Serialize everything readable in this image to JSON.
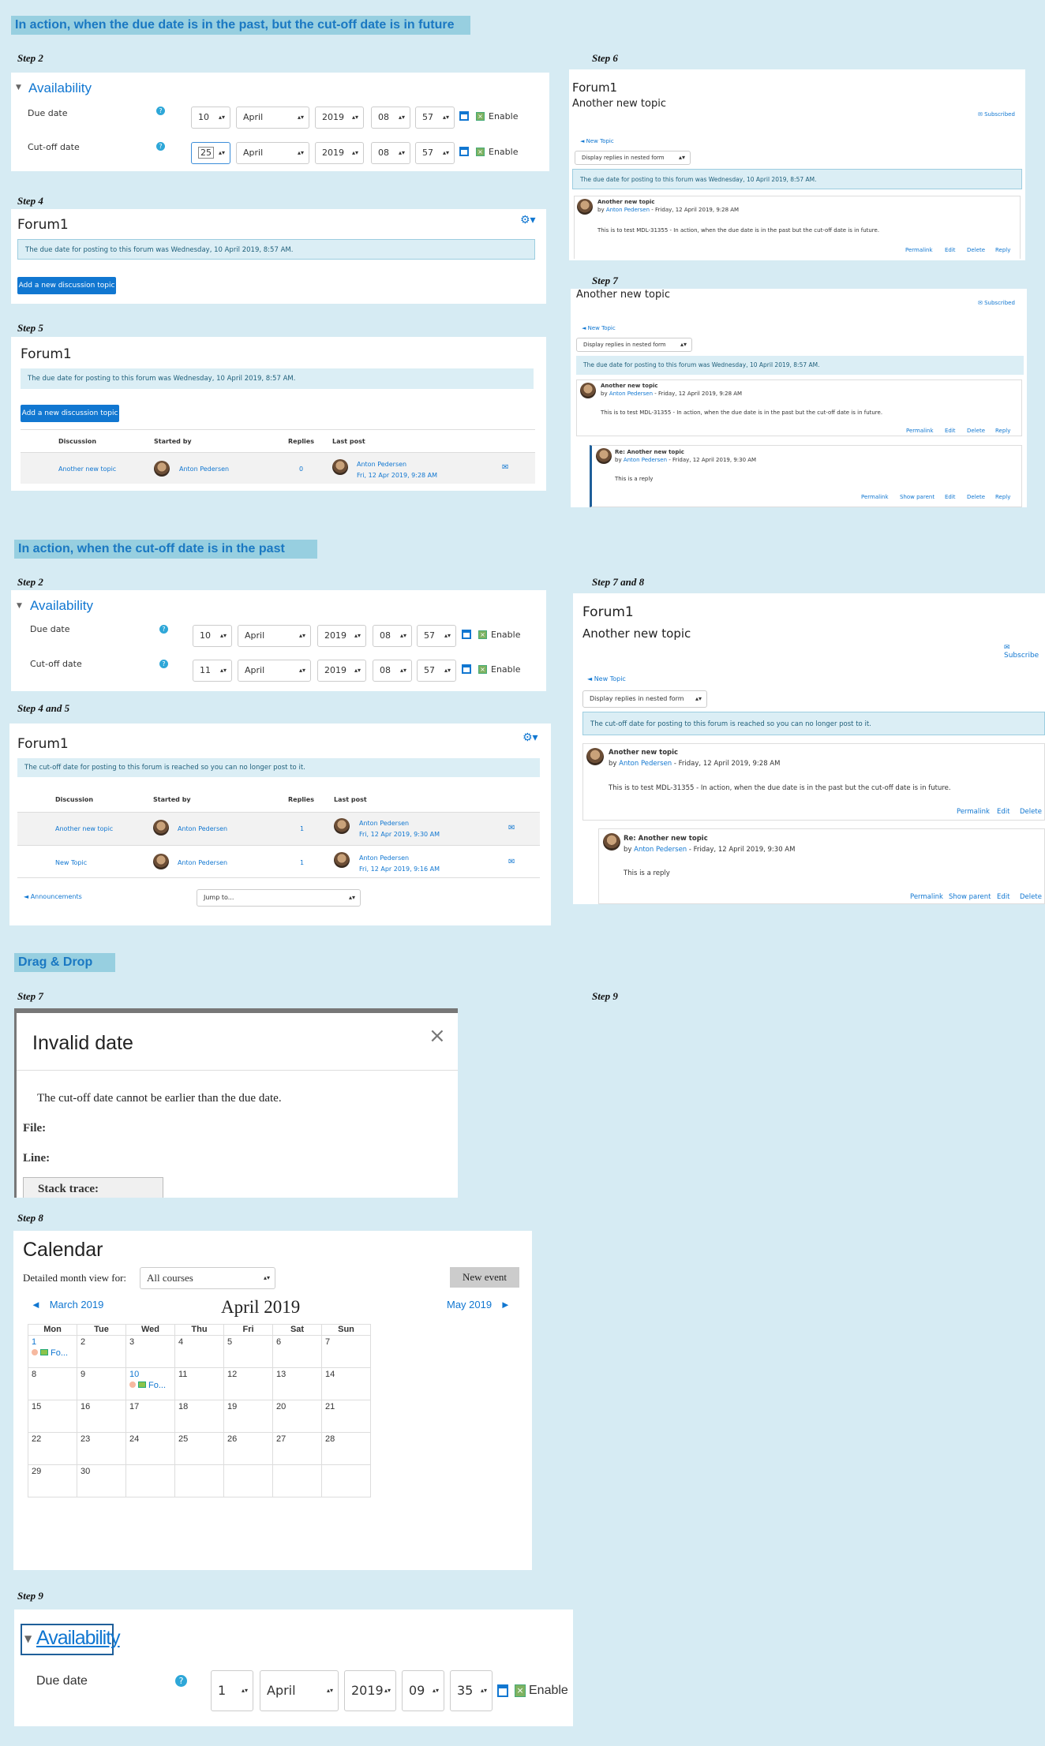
{
  "section1": {
    "banner": "In action, when the due date is in the past, but the cut-off date is in future",
    "step2": {
      "label": "Step 2",
      "heading": "Availability",
      "due": {
        "label": "Due date",
        "day": "10",
        "month": "April",
        "year": "2019",
        "hour": "08",
        "min": "57",
        "enable": "Enable"
      },
      "cutoff": {
        "label": "Cut-off date",
        "day": "25",
        "month": "April",
        "year": "2019",
        "hour": "08",
        "min": "57",
        "enable": "Enable"
      }
    },
    "step4": {
      "label": "Step 4",
      "title": "Forum1",
      "notice": "The due date for posting to this forum was Wednesday, 10 April 2019, 8:57 AM.",
      "button": "Add a new discussion topic"
    },
    "step5": {
      "label": "Step 5",
      "title": "Forum1",
      "notice": "The due date for posting to this forum was Wednesday, 10 April 2019, 8:57 AM.",
      "button": "Add a new discussion topic",
      "cols": [
        "Discussion",
        "Started by",
        "Replies",
        "Last post"
      ],
      "row": {
        "topic": "Another new topic",
        "author": "Anton Pedersen",
        "replies": "0",
        "last_author": "Anton Pedersen",
        "last_date": "Fri, 12 Apr 2019, 9:28 AM"
      }
    },
    "step6": {
      "label": "Step 6",
      "forum": "Forum1",
      "topic": "Another new topic",
      "subscribed": "Subscribed",
      "back": "◄ New Topic",
      "display": "Display replies in nested form",
      "notice": "The due date for posting to this forum was Wednesday, 10 April 2019, 8:57 AM.",
      "post": {
        "title": "Another new topic",
        "by": "by",
        "author": "Anton Pedersen",
        "date": "- Friday, 12 April 2019, 9:28 AM",
        "body": "This is to test MDL-31355 - In action, when the due date is in the past but the cut-off date is in future."
      },
      "actions": [
        "Permalink",
        "Edit",
        "Delete",
        "Reply"
      ]
    },
    "step7": {
      "label": "Step 7",
      "topic": "Another new topic",
      "subscribed": "Subscribed",
      "back": "◄ New Topic",
      "display": "Display replies in nested form",
      "notice": "The due date for posting to this forum was Wednesday, 10 April 2019, 8:57 AM.",
      "post": {
        "title": "Another new topic",
        "by": "by",
        "author": "Anton Pedersen",
        "date": "- Friday, 12 April 2019, 9:28 AM",
        "body": "This is to test MDL-31355 - In action, when the due date is in the past but the cut-off date is in future."
      },
      "actions": [
        "Permalink",
        "Edit",
        "Delete",
        "Reply"
      ],
      "reply": {
        "title": "Re: Another new topic",
        "by": "by",
        "author": "Anton Pedersen",
        "date": "- Friday, 12 April 2019, 9:30 AM",
        "body": "This is a reply"
      },
      "reply_actions": [
        "Permalink",
        "Show parent",
        "Edit",
        "Delete",
        "Reply"
      ]
    }
  },
  "section2": {
    "banner": "In action, when the cut-off date is in the past",
    "step2": {
      "label": "Step 2",
      "heading": "Availability",
      "due": {
        "label": "Due date",
        "day": "10",
        "month": "April",
        "year": "2019",
        "hour": "08",
        "min": "57",
        "enable": "Enable"
      },
      "cutoff": {
        "label": "Cut-off date",
        "day": "11",
        "month": "April",
        "year": "2019",
        "hour": "08",
        "min": "57",
        "enable": "Enable"
      }
    },
    "step45": {
      "label": "Step 4 and 5",
      "title": "Forum1",
      "notice": "The cut-off date for posting to this forum is reached so you can no longer post to it.",
      "cols": [
        "Discussion",
        "Started by",
        "Replies",
        "Last post"
      ],
      "rows": [
        {
          "topic": "Another new topic",
          "author": "Anton Pedersen",
          "replies": "1",
          "last_author": "Anton Pedersen",
          "last_date": "Fri, 12 Apr 2019, 9:30 AM"
        },
        {
          "topic": "New Topic",
          "author": "Anton Pedersen",
          "replies": "1",
          "last_author": "Anton Pedersen",
          "last_date": "Fri, 12 Apr 2019, 9:16 AM"
        }
      ],
      "announcements": "◄ Announcements",
      "jump": "Jump to..."
    },
    "step78": {
      "label": "Step 7 and 8",
      "forum": "Forum1",
      "topic": "Another new topic",
      "subscribed": "Subscribe",
      "back": "◄ New Topic",
      "display": "Display replies in nested form",
      "notice": "The cut-off date for posting to this forum is reached so you can no longer post to it.",
      "post": {
        "title": "Another new topic",
        "by": "by",
        "author": "Anton Pedersen",
        "date": "- Friday, 12 April 2019, 9:28 AM",
        "body": "This is to test MDL-31355 - In action, when the due date is in the past but the cut-off date is in future."
      },
      "actions": [
        "Permalink",
        "Edit",
        "Delete"
      ],
      "reply": {
        "title": "Re: Another new topic",
        "by": "by",
        "author": "Anton Pedersen",
        "date": "- Friday, 12 April 2019, 9:30 AM",
        "body": "This is a reply"
      },
      "reply_actions": [
        "Permalink",
        "Show parent",
        "Edit",
        "Delete"
      ]
    }
  },
  "section3": {
    "banner": "Drag & Drop",
    "step7": {
      "label": "Step 7",
      "title": "Invalid date",
      "close": "×",
      "message": "The cut-off date cannot be earlier than the due date.",
      "file": "File:",
      "line": "Line:",
      "stack": "Stack trace:"
    },
    "step9_top": {
      "label": "Step 9"
    },
    "step8": {
      "label": "Step 8",
      "title": "Calendar",
      "filter_label": "Detailed month view for:",
      "filter_value": "All courses",
      "new_event": "New event",
      "prev": "◄   March 2019",
      "month": "April 2019",
      "next": "May 2019   ►",
      "days": [
        "Mon",
        "Tue",
        "Wed",
        "Thu",
        "Fri",
        "Sat",
        "Sun"
      ],
      "weeks": [
        [
          "1",
          "2",
          "3",
          "4",
          "5",
          "6",
          "7"
        ],
        [
          "8",
          "9",
          "10",
          "11",
          "12",
          "13",
          "14"
        ],
        [
          "15",
          "16",
          "17",
          "18",
          "19",
          "20",
          "21"
        ],
        [
          "22",
          "23",
          "24",
          "25",
          "26",
          "27",
          "28"
        ],
        [
          "29",
          "30",
          "",
          "",
          "",
          "",
          ""
        ]
      ],
      "event_label": "Fo..."
    },
    "step9": {
      "label": "Step 9",
      "heading": "Availability",
      "due": {
        "label": "Due date",
        "day": "1",
        "month": "April",
        "year": "2019",
        "hour": "09",
        "min": "35",
        "enable": "Enable"
      }
    }
  },
  "colors": {
    "link": "#1177d1",
    "banner": "#97cfe0",
    "bg": "#d6ebf3",
    "notice": "#dbeef5"
  },
  "icons": [
    "help-icon",
    "calendar-icon",
    "checkbox-icon",
    "gear-icon",
    "mail-icon",
    "close-icon",
    "avatar"
  ]
}
